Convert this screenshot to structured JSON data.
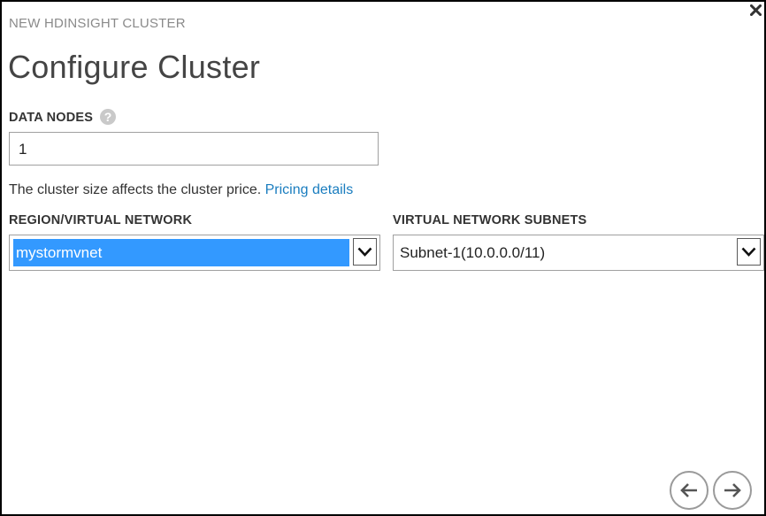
{
  "dialog": {
    "kicker": "NEW HDINSIGHT CLUSTER",
    "title": "Configure Cluster",
    "close_icon": "close-icon"
  },
  "data_nodes": {
    "label": "DATA NODES",
    "help_glyph": "?",
    "value": "1"
  },
  "hint": {
    "text": "The cluster size affects the cluster price.",
    "link": "Pricing details"
  },
  "region": {
    "label": "REGION/VIRTUAL NETWORK",
    "selected": "mystormvnet"
  },
  "subnets": {
    "label": "VIRTUAL NETWORK SUBNETS",
    "selected": "Subnet-1(10.0.0.0/11)"
  },
  "navigation": {
    "back_icon": "arrow-left-icon",
    "next_icon": "arrow-right-icon"
  },
  "colors": {
    "accent_link": "#1a7dbf",
    "selection": "#3399ff",
    "muted_text": "#8a8a8a"
  }
}
